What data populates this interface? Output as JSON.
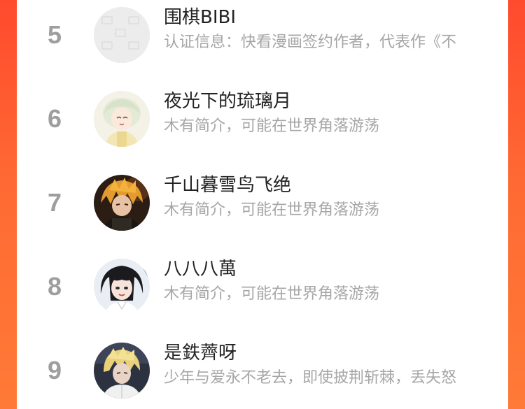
{
  "ranking": {
    "items": [
      {
        "rank": "5",
        "name": "围棋BIBI",
        "desc": "认证信息：快看漫画签约作者，代表作《不",
        "avatar": "placeholder-image-icon"
      },
      {
        "rank": "6",
        "name": "夜光下的琉璃月",
        "desc": "木有简介，可能在世界角落游荡",
        "avatar": "anime-avatar-white-hair"
      },
      {
        "rank": "7",
        "name": "千山暮雪鸟飞绝",
        "desc": "木有简介，可能在世界角落游荡",
        "avatar": "anime-avatar-orange-hair"
      },
      {
        "rank": "8",
        "name": "八八八萬",
        "desc": "木有简介，可能在世界角落游荡",
        "avatar": "anime-avatar-dark-hair"
      },
      {
        "rank": "9",
        "name": "是鉄薺呀",
        "desc": "少年与爱永不老去，即使披荆斩棘，丢失怒",
        "avatar": "anime-avatar-blond-hair"
      }
    ]
  },
  "colors": {
    "background_gradient_top": "#ff4a2e",
    "background_gradient_bottom": "#ff7a36",
    "panel": "#ffffff",
    "rank_text": "#9e9e9e",
    "name_text": "#222222",
    "desc_text": "#a6a6a6"
  }
}
